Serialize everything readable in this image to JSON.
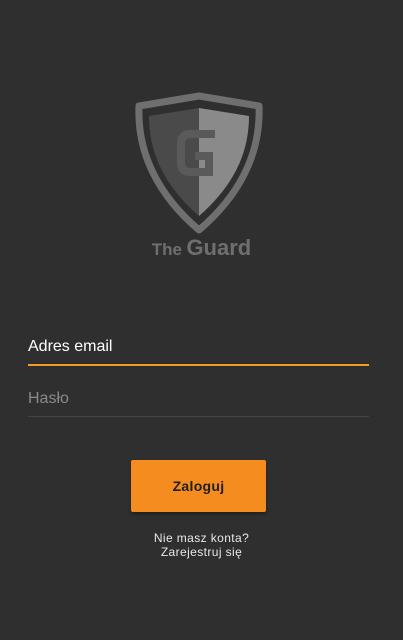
{
  "brand": {
    "prefix": "The",
    "name": "Guard",
    "logo_letter": "G",
    "logo_icon": "shield-logo-icon"
  },
  "form": {
    "email_placeholder": "Adres email",
    "password_placeholder": "Hasło",
    "login_label": "Zaloguj"
  },
  "register": {
    "line1": "Nie masz konta?",
    "line2": "Zarejestruj się"
  },
  "colors": {
    "background": "#2f2f2f",
    "accent": "#f58c1f",
    "logo": "#6f6f6f"
  }
}
